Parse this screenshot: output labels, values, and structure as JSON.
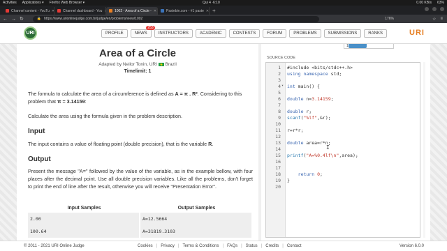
{
  "os_bar": {
    "activities": "Activities",
    "applications": "Applications ▾",
    "browser": "Firefox Web Browser ▾",
    "clock": "Qui 4 ·6:10",
    "net_speed": "0.00 KB/s",
    "battery": "63%"
  },
  "tabs": [
    {
      "label": "Channel content - YouTu",
      "color": "#e53935",
      "active": false
    },
    {
      "label": "Channel dashboard - You",
      "color": "#e53935",
      "active": false
    },
    {
      "label": "1002 - Area of a Circle -",
      "color": "#e67e22",
      "active": true
    },
    {
      "label": "Pastebin.com - #1 paste",
      "color": "#3b73b9",
      "active": false
    }
  ],
  "navbar": {
    "url": "https://www.urionlinejudge.com.br/judge/en/problems/view/1002",
    "zoom": "176%"
  },
  "site": {
    "logo": "URI",
    "brand": "URI",
    "menu": [
      "PROFILE",
      "NEWS",
      "INSTRUCTORS",
      "ACADEMIC",
      "CONTESTS",
      "FORUM",
      "PROBLEMS",
      "SUBMISSIONS",
      "RANKS"
    ],
    "news_badge": "253"
  },
  "problem": {
    "title": "Area of a Circle",
    "adapted_by": "Adapted by Neilor Tonin, URI",
    "country": "Brazil",
    "timelimit": "Timelimit: 1",
    "intro_pre": "The formula to calculate the area of a circumference is defined as ",
    "intro_formula": "A = π . R²",
    "intro_mid": ". Considering to this problem that ",
    "intro_pi": "π = 3.14159",
    "intro_post": ":",
    "calc": "Calculate the area using the formula given in the problem description.",
    "input_heading": "Input",
    "input_text_pre": "The input contains a value of floating point (double precision), that is the variable ",
    "input_var": "R",
    "input_text_post": ".",
    "output_heading": "Output",
    "output_text": "Present the message \"A=\" followed by the value of the variable, as in the example bellow, with four places after the decimal point. Use all double precision variables. Like all the problems, don't forget to print the end of line after the result, otherwise you will receive \"Presentation Error\".",
    "samples_header": [
      "Input Samples",
      "Output Samples"
    ],
    "samples": [
      {
        "input": "2.00",
        "output": "A=12.5664"
      },
      {
        "input": "100.64",
        "output": "A=31819.3103"
      }
    ]
  },
  "editor": {
    "language_value": "1002",
    "source_label": "SOURCE CODE",
    "lines": [
      {
        "n": "1",
        "code": "#include <bits/stdc++.h>"
      },
      {
        "n": "2",
        "code": "using namespace std;"
      },
      {
        "n": "3",
        "code": ""
      },
      {
        "n": "4",
        "code": "int main() {"
      },
      {
        "n": "5",
        "code": ""
      },
      {
        "n": "6",
        "code": "double n=3.14159;"
      },
      {
        "n": "7",
        "code": ""
      },
      {
        "n": "8",
        "code": "double r;"
      },
      {
        "n": "9",
        "code": "scanf(\"%lf\",&r);"
      },
      {
        "n": "10",
        "code": ""
      },
      {
        "n": "11",
        "code": "r=r*r;"
      },
      {
        "n": "12",
        "code": ""
      },
      {
        "n": "13",
        "code": "double area=r*n;"
      },
      {
        "n": "14",
        "code": ""
      },
      {
        "n": "15",
        "code": "printf(\"A=%0.4lf\\n\",area);"
      },
      {
        "n": "16",
        "code": ""
      },
      {
        "n": "17",
        "code": ""
      },
      {
        "n": "18",
        "code": "    return 0;"
      },
      {
        "n": "19",
        "code": "}"
      },
      {
        "n": "20",
        "code": ""
      }
    ]
  },
  "footer": {
    "copyright": "© 2011 - 2021 URI Online Judge",
    "links": [
      "Cookies",
      "Privacy",
      "Terms & Conditions",
      "FAQs",
      "Status",
      "Credits",
      "Contact"
    ],
    "version": "Version 6.0.0"
  }
}
